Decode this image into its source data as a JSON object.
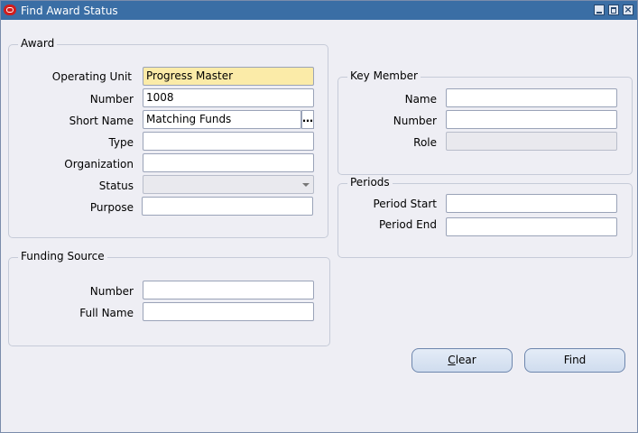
{
  "window": {
    "title": "Find Award Status"
  },
  "award": {
    "legend": "Award",
    "operating_unit": {
      "label": "Operating Unit",
      "value": "Progress Master"
    },
    "number": {
      "label": "Number",
      "value": "1008"
    },
    "short_name": {
      "label": "Short Name",
      "value": "Matching Funds",
      "lov": "…"
    },
    "type": {
      "label": "Type",
      "value": ""
    },
    "organization": {
      "label": "Organization",
      "value": ""
    },
    "status": {
      "label": "Status",
      "value": ""
    },
    "purpose": {
      "label": "Purpose",
      "value": ""
    }
  },
  "funding_source": {
    "legend": "Funding Source",
    "number": {
      "label": "Number",
      "value": ""
    },
    "full_name": {
      "label": "Full Name",
      "value": ""
    }
  },
  "key_member": {
    "legend": "Key Member",
    "name": {
      "label": "Name",
      "value": ""
    },
    "number": {
      "label": "Number",
      "value": ""
    },
    "role": {
      "label": "Role",
      "value": ""
    }
  },
  "periods": {
    "legend": "Periods",
    "period_start": {
      "label": "Period Start",
      "value": ""
    },
    "period_end": {
      "label": "Period End",
      "value": ""
    }
  },
  "buttons": {
    "clear_first": "C",
    "clear_rest": "lear",
    "find": "Find"
  }
}
